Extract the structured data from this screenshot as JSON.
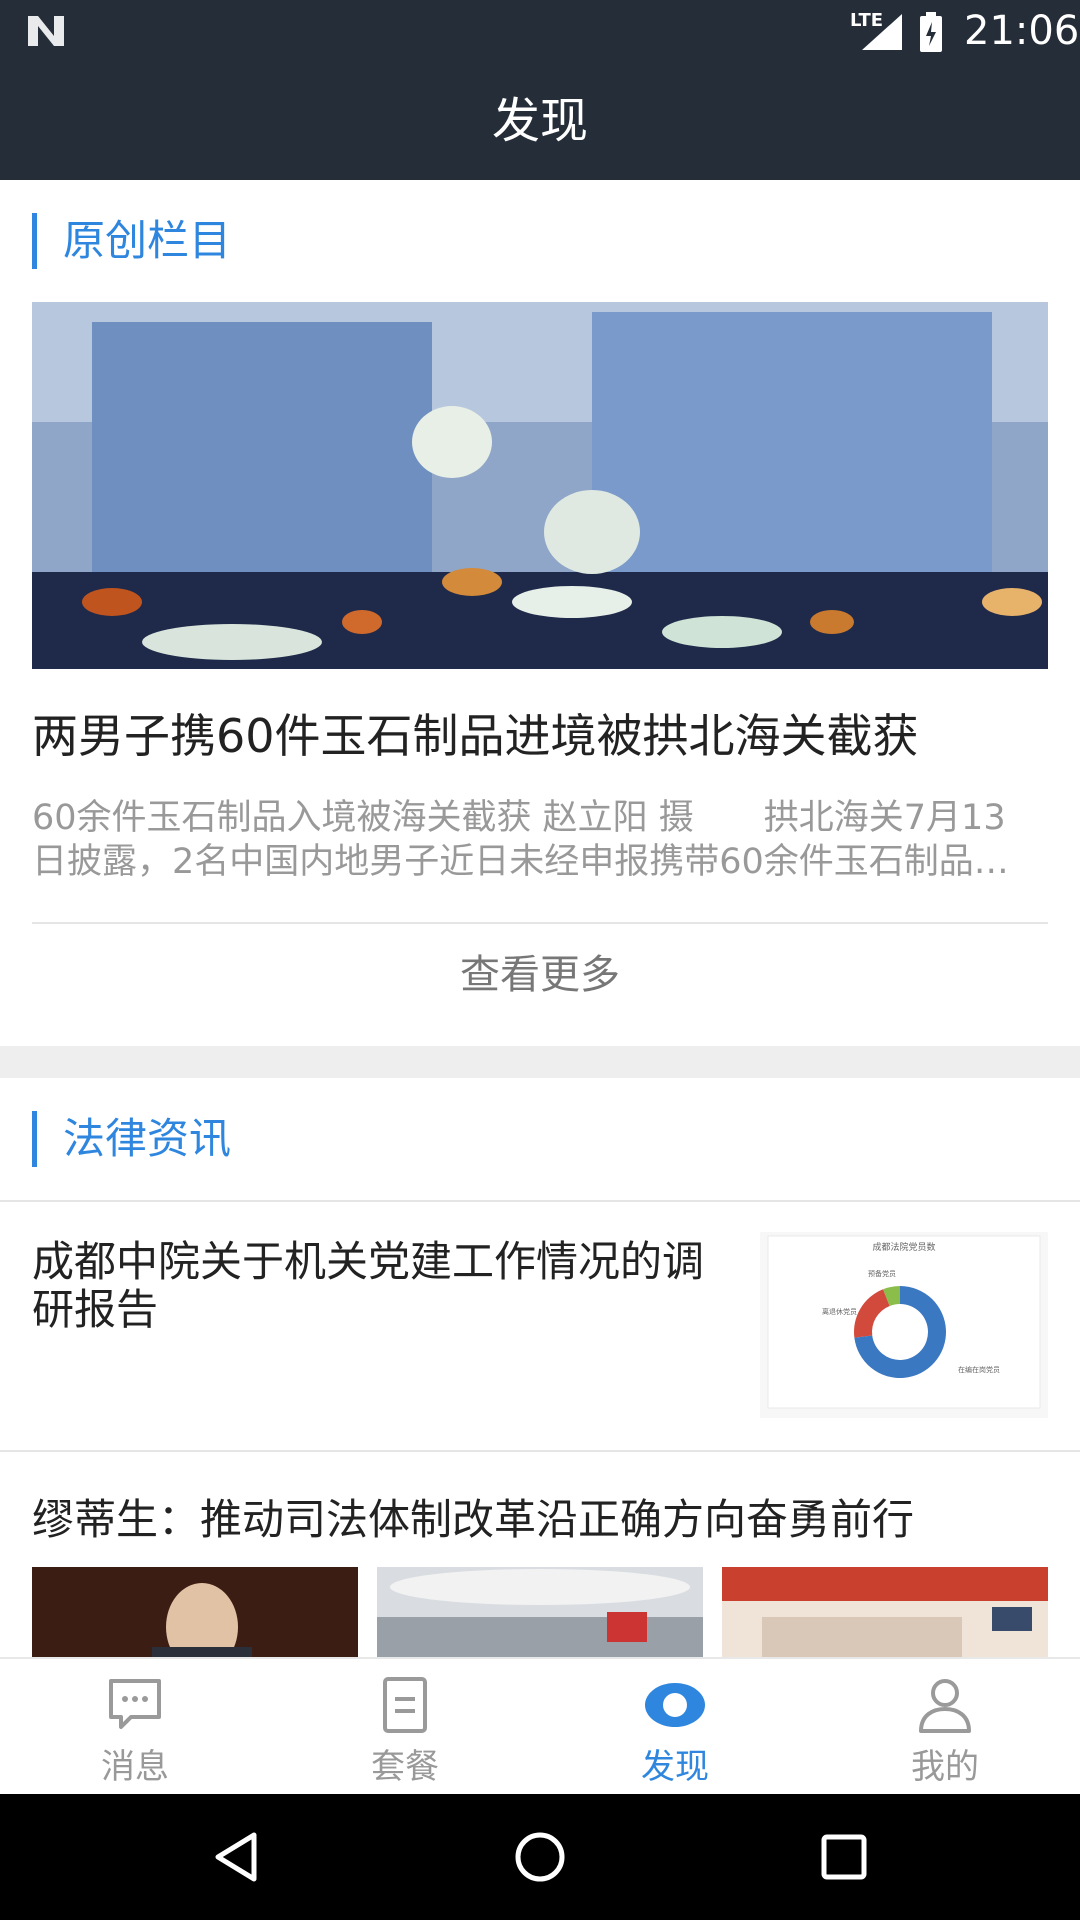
{
  "status_bar": {
    "network": "LTE",
    "time": "21:06"
  },
  "app_bar": {
    "title": "发现"
  },
  "original_section": {
    "header": "原创栏目",
    "headline": "两男子携60件玉石制品进境被拱北海关截获",
    "summary_line1": "60余件玉石制品入境被海关截获 赵立阳 摄　　拱北海关7月13",
    "summary_line2": "日披露，2名中国内地男子近日未经申报携带60余件玉石制品…",
    "more_label": "查看更多"
  },
  "legal_section": {
    "header": "法律资讯",
    "items": [
      {
        "title": "成都中院关于机关党建工作情况的调研报告"
      },
      {
        "title": "缪蒂生：推动司法体制改革沿正确方向奋勇前行"
      }
    ]
  },
  "thumbnail_chart": {
    "title": "成都法院党员数",
    "labels": [
      "离退休党员",
      "预备党员",
      "在编在岗党员"
    ],
    "percentages": [
      21,
      6,
      73
    ]
  },
  "tabs": [
    {
      "label": "消息",
      "icon": "message-icon"
    },
    {
      "label": "套餐",
      "icon": "document-icon"
    },
    {
      "label": "发现",
      "icon": "discover-icon"
    },
    {
      "label": "我的",
      "icon": "user-icon"
    }
  ],
  "colors": {
    "accent": "#2e86de",
    "header_bg": "#252e38"
  }
}
